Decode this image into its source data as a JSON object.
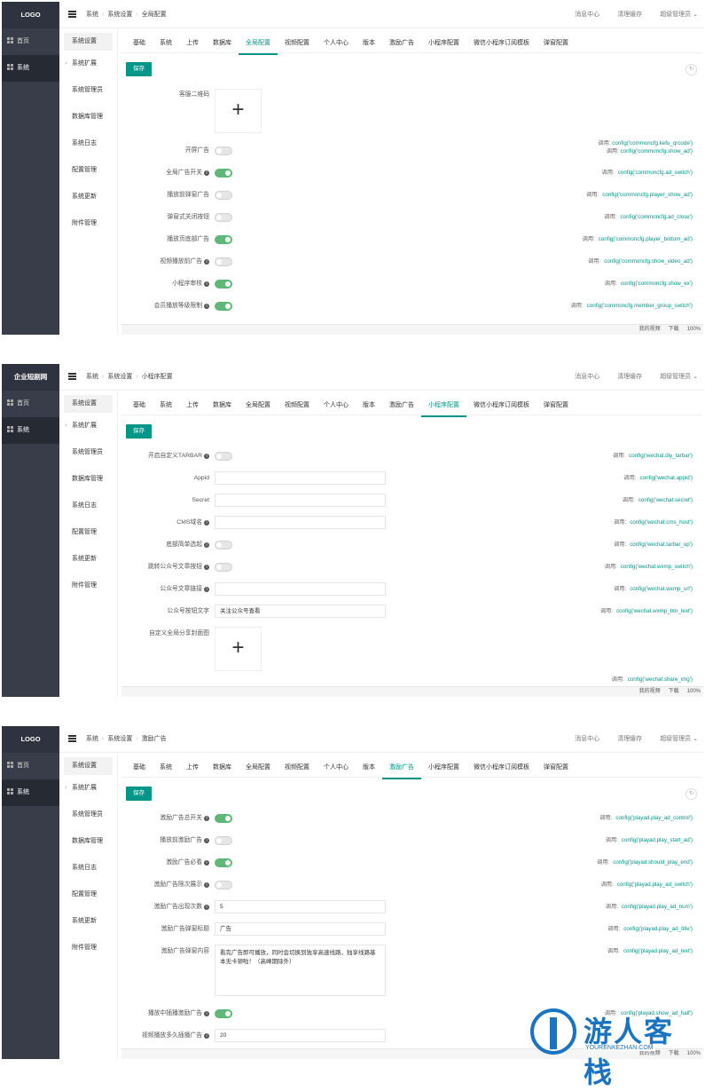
{
  "sidebar": {
    "home": "首页",
    "system": "系统"
  },
  "submenu": {
    "items": [
      "系统设置",
      "系统扩展",
      "系统管理员",
      "数据库管理",
      "系统日志",
      "配置管理",
      "系统更新",
      "附件管理"
    ]
  },
  "topbar": {
    "crumb1": "系统",
    "crumb2": "系统设置",
    "msg": "消息中心",
    "cache": "清理缓存",
    "user": "超级管理员"
  },
  "tabs": [
    "基础",
    "系统",
    "上传",
    "数据库",
    "全局配置",
    "视频配置",
    "个人中心",
    "版本",
    "激励广告",
    "小程序配置",
    "微信小程序订阅模板",
    "弹窗配置"
  ],
  "save_label": "保存",
  "hint_prefix": "调用:",
  "status": {
    "video": "我的视频",
    "dl": "下载",
    "zoom": "100%"
  },
  "panels": [
    {
      "logo": "LOGO",
      "crumb3": "全局配置",
      "active_tab": "全局配置",
      "upload": {
        "label": "客服二维码"
      },
      "ad_hint": {
        "h1": "config('commoncfg.kefu_qrcode')",
        "h2": "config('commoncfg.show_ad')"
      },
      "rows": [
        {
          "label": "开屏广告",
          "type": "switch",
          "on": false,
          "info": false
        },
        {
          "label": "全局广告开关",
          "type": "switch",
          "on": true,
          "info": true,
          "hint": "config('commoncfg.ad_switch')"
        },
        {
          "label": "播放前弹窗广告",
          "type": "switch",
          "on": false,
          "info": false,
          "hint": "config('commoncfg.player_show_ad')"
        },
        {
          "label": "弹窗式关闭按钮",
          "type": "switch",
          "on": false,
          "info": false,
          "hint": "config('commoncfg.ad_close')"
        },
        {
          "label": "播放页底部广告",
          "type": "switch",
          "on": true,
          "info": false,
          "hint": "config('commoncfg.player_bottom_ad')"
        },
        {
          "label": "视频播放前广告",
          "type": "switch",
          "on": false,
          "info": true,
          "hint": "config('commoncfg.show_video_ad')"
        },
        {
          "label": "小程序审核",
          "type": "switch",
          "on": true,
          "info": true,
          "hint": "config('commoncfg.show_ex')"
        },
        {
          "label": "会员播放等级限制",
          "type": "switch",
          "on": true,
          "info": true,
          "hint": "config('commoncfg.member_group_switch')"
        }
      ]
    },
    {
      "logo": "企业短剧网",
      "crumb3": "小程序配置",
      "active_tab": "小程序配置",
      "rows": [
        {
          "label": "开启自定义TARBAR",
          "type": "switch",
          "on": false,
          "info": true,
          "hint": "config('wechat.diy_tarbar')"
        },
        {
          "label": "Appid",
          "type": "input",
          "value": "",
          "info": false,
          "hint": "config('wechat.appid')"
        },
        {
          "label": "Secret",
          "type": "input",
          "value": "",
          "info": false,
          "hint": "config('wechat.secret')"
        },
        {
          "label": "CMS域名",
          "type": "input",
          "value": "",
          "info": true,
          "hint": "config('wechat.cms_host')"
        },
        {
          "label": "底部简单选起",
          "type": "switch",
          "on": false,
          "info": true,
          "hint": "config('wechat.tarbar_up')"
        },
        {
          "label": "跳转公众号文章按钮",
          "type": "switch",
          "on": false,
          "info": true,
          "hint": "config('wechat.wxmp_switch')"
        },
        {
          "label": "公众号文章链接",
          "type": "input",
          "value": "",
          "info": true,
          "hint": "config('wechat.wxmp_url')"
        },
        {
          "label": "公众号按钮文字",
          "type": "input",
          "value": "关注公众号查看",
          "info": false,
          "hint": "config('wechat.wxmp_btn_text')"
        }
      ],
      "upload": {
        "label": "自定义全局分享封面图",
        "hint": "config('wechat.share_img')"
      }
    },
    {
      "logo": "LOGO",
      "crumb3": "激励广告",
      "active_tab": "激励广告",
      "rows": [
        {
          "label": "激励广告总开关",
          "type": "switch",
          "on": true,
          "info": true,
          "hint": "config('playad.play_ad_control')"
        },
        {
          "label": "播放前激励广告",
          "type": "switch",
          "on": false,
          "info": true,
          "hint": "config('playad.play_start_ad')"
        },
        {
          "label": "激励广告必看",
          "type": "switch",
          "on": true,
          "info": true,
          "hint": "config('playad.should_play_end')"
        },
        {
          "label": "激励广告限次展示",
          "type": "switch",
          "on": false,
          "info": true,
          "hint": "config('playad.play_ad_switch')"
        },
        {
          "label": "激励广告出现次数",
          "type": "input",
          "value": "5",
          "info": true,
          "hint": "config('playad.play_ad_num')"
        },
        {
          "label": "激励广告弹窗标题",
          "type": "input",
          "value": "广告",
          "info": false,
          "hint": "config('playad.play_ad_title')"
        },
        {
          "label": "激励广告弹窗内容",
          "type": "textarea",
          "value": "看完广告即可播放，同时会切换到独享高速线路，独享线路基本无卡顿啦！（高峰期除外）",
          "info": false,
          "hint": "config('playad.play_ad_text')"
        },
        {
          "label": "播放中插播激励广告",
          "type": "switch",
          "on": true,
          "info": true,
          "hint": "config('playad.show_ad_half')"
        },
        {
          "label": "视频播放多久插播广告",
          "type": "input",
          "value": "20",
          "info": true,
          "hint": ""
        }
      ]
    }
  ],
  "watermark": {
    "text": "游人客栈",
    "url": "YOURENKEZHAN.COM"
  }
}
